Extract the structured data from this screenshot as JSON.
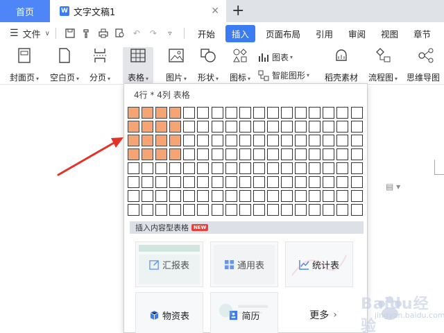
{
  "tabs": {
    "home": "首页",
    "document": "文字文稿1",
    "doc_icon_letter": "W",
    "close": "✕",
    "add": "+"
  },
  "menu": {
    "file": "文件",
    "ribbon_tabs": [
      "开始",
      "插入",
      "页面布局",
      "引用",
      "审阅",
      "视图",
      "章节"
    ],
    "active_tab": "插入"
  },
  "ribbon": {
    "cover": "封面页",
    "blank": "空白页",
    "pagebreak": "分页",
    "table": "表格",
    "picture": "图片",
    "shape": "形状",
    "icon": "图标",
    "chart": "图表",
    "smartart": "智能图形",
    "material": "稻壳素材",
    "flowchart": "流程图",
    "mindmap": "思维导图"
  },
  "dropdown": {
    "title": "4行 * 4列 表格",
    "grid_rows": 8,
    "grid_cols": 17,
    "selected_rows": 4,
    "selected_cols": 4,
    "section": "插入内容型表格",
    "new_badge": "NEW",
    "cards": [
      "汇报表",
      "通用表",
      "统计表",
      "物资表",
      "简历"
    ],
    "more": "更多"
  },
  "colors": {
    "accent": "#3b7cf2",
    "home_tab": "#4f86f7",
    "selected_cell": "#f6a473",
    "arrow": "#e53227"
  },
  "watermark": {
    "brand": "Baidu经验",
    "url": "jingyan.baidu.com"
  }
}
